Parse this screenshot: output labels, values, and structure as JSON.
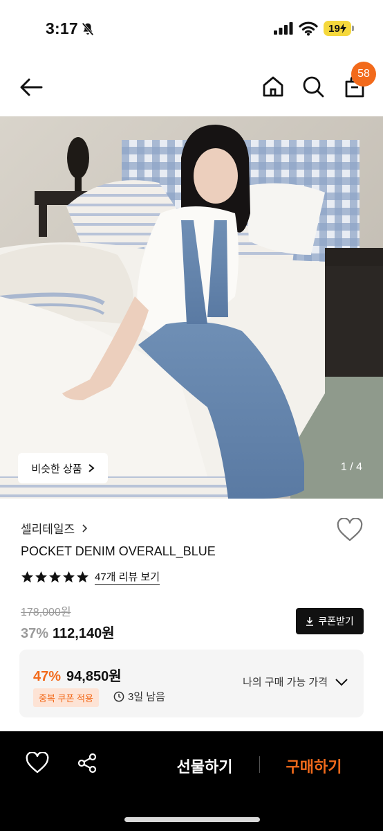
{
  "status_bar": {
    "time": "3:17",
    "battery": "19"
  },
  "header": {
    "cart_count": "58"
  },
  "image": {
    "similar_label": "비슷한 상품",
    "counter": "1 / 4"
  },
  "product": {
    "brand": "셀리테일즈",
    "name": "POCKET DENIM OVERALL_BLUE",
    "rating_stars": 5,
    "review_link": "47개 리뷰 보기",
    "original_price": "178,000원",
    "discount": "37%",
    "price": "112,140원",
    "coupon_button": "쿠폰받기"
  },
  "benefit": {
    "discount": "47%",
    "price": "94,850원",
    "coupon_tag": "중복 쿠폰 적용",
    "remaining": "3일 남음",
    "my_price_label": "나의 구매 가능 가격"
  },
  "bottom_bar": {
    "gift_label": "선물하기",
    "buy_label": "구매하기"
  },
  "colors": {
    "accent": "#f26a1b",
    "battery": "#f5d83c",
    "bottom_bar": "#000000"
  }
}
